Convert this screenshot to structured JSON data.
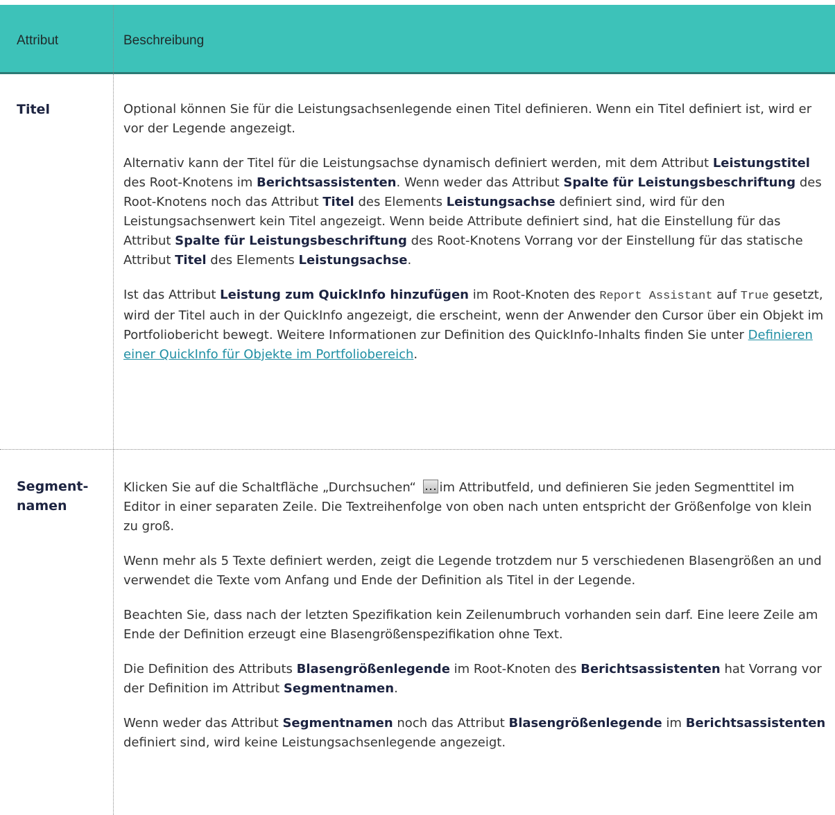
{
  "table": {
    "header": {
      "col_attribute": "Attribut",
      "col_description": "Beschreibung"
    },
    "rows": [
      {
        "name": "Titel",
        "paragraphs": [
          {
            "parts": [
              "Optional können Sie für die Leistungsachsenlegende einen Titel definieren. Wenn ein Titel definiert ist, wird er vor der Legende angezeigt."
            ]
          },
          {
            "parts": [
              "Alternativ kann der Titel für die Leistungsachse dynamisch definiert werden, mit dem Attribut ",
              "Leistungstitel",
              " des Root-Knotens im ",
              "Berichtsassistenten",
              ". Wenn weder das Attribut ",
              "Spalte für Leistungsbeschriftung",
              " des Root-Knotens noch das Attribut ",
              "Titel",
              " des Elements ",
              "Leistungsachse",
              " definiert sind, wird für den Leistungsachsenwert kein Titel angezeigt. Wenn beide Attribute definiert sind, hat die Einstellung für das Attribut ",
              "Spalte für Leistungsbeschriftung",
              " des Root-Knotens Vorrang vor der Einstellung für das statische Attribut ",
              "Titel",
              " des Elements ",
              "Leistungsachse",
              "."
            ]
          },
          {
            "parts": [
              "Ist das Attribut ",
              "Leistung zum QuickInfo hinzufügen",
              " im Root-Knoten des ",
              "Report Assistant",
              " auf ",
              "True",
              " gesetzt, wird der Titel auch in der QuickInfo angezeigt, die erscheint, wenn der Anwender den Cursor über ein Objekt im Portfoliobericht bewegt. Weitere Informationen zur Definition des QuickInfo-Inhalts finden Sie unter ",
              "Definieren einer QuickInfo für Objekte im Portfoliobereich",
              "."
            ]
          }
        ]
      },
      {
        "name": "Segmentnamen",
        "name_lines": [
          "Segment-",
          "namen"
        ],
        "paragraphs": [
          {
            "parts": [
              "Klicken Sie auf die Schaltfläche „Durchsuchen“ ",
              "im Attributfeld, und definieren Sie jeden Segmenttitel im Editor in einer separaten Zeile. Die Textreihenfolge von oben nach unten entspricht der Größenfolge von klein zu groß."
            ]
          },
          {
            "parts": [
              "Wenn mehr als 5 Texte definiert werden, zeigt die Legende trotzdem nur 5 verschiedenen Blasengrößen an und verwendet die Texte vom Anfang und Ende der Definition als Titel in der Legende."
            ]
          },
          {
            "parts": [
              "Beachten Sie, dass nach der letzten Spezifikation kein Zeilenumbruch vorhanden sein darf. Eine leere Zeile am Ende der Definition erzeugt eine Blasengrößenspezifikation ohne Text."
            ]
          },
          {
            "parts": [
              "Die Definition des Attributs ",
              "Blasengrößenlegende",
              " im Root-Knoten des ",
              "Berichtsassistenten",
              " hat Vorrang vor der Definition im Attribut ",
              "Segmentnamen",
              "."
            ]
          },
          {
            "parts": [
              "Wenn weder das Attribut ",
              "Segmentnamen",
              " noch das Attribut ",
              "Blasengrößenlegende",
              " im ",
              "Berichtsassistenten",
              " definiert sind, wird keine Leistungsachsenlegende angezeigt."
            ]
          }
        ]
      }
    ]
  },
  "icons": {
    "browse": "browse-button-icon"
  },
  "colors": {
    "header_bg": "#3dc2b9",
    "link": "#1f8ea3",
    "bold_text": "#1c2340"
  }
}
